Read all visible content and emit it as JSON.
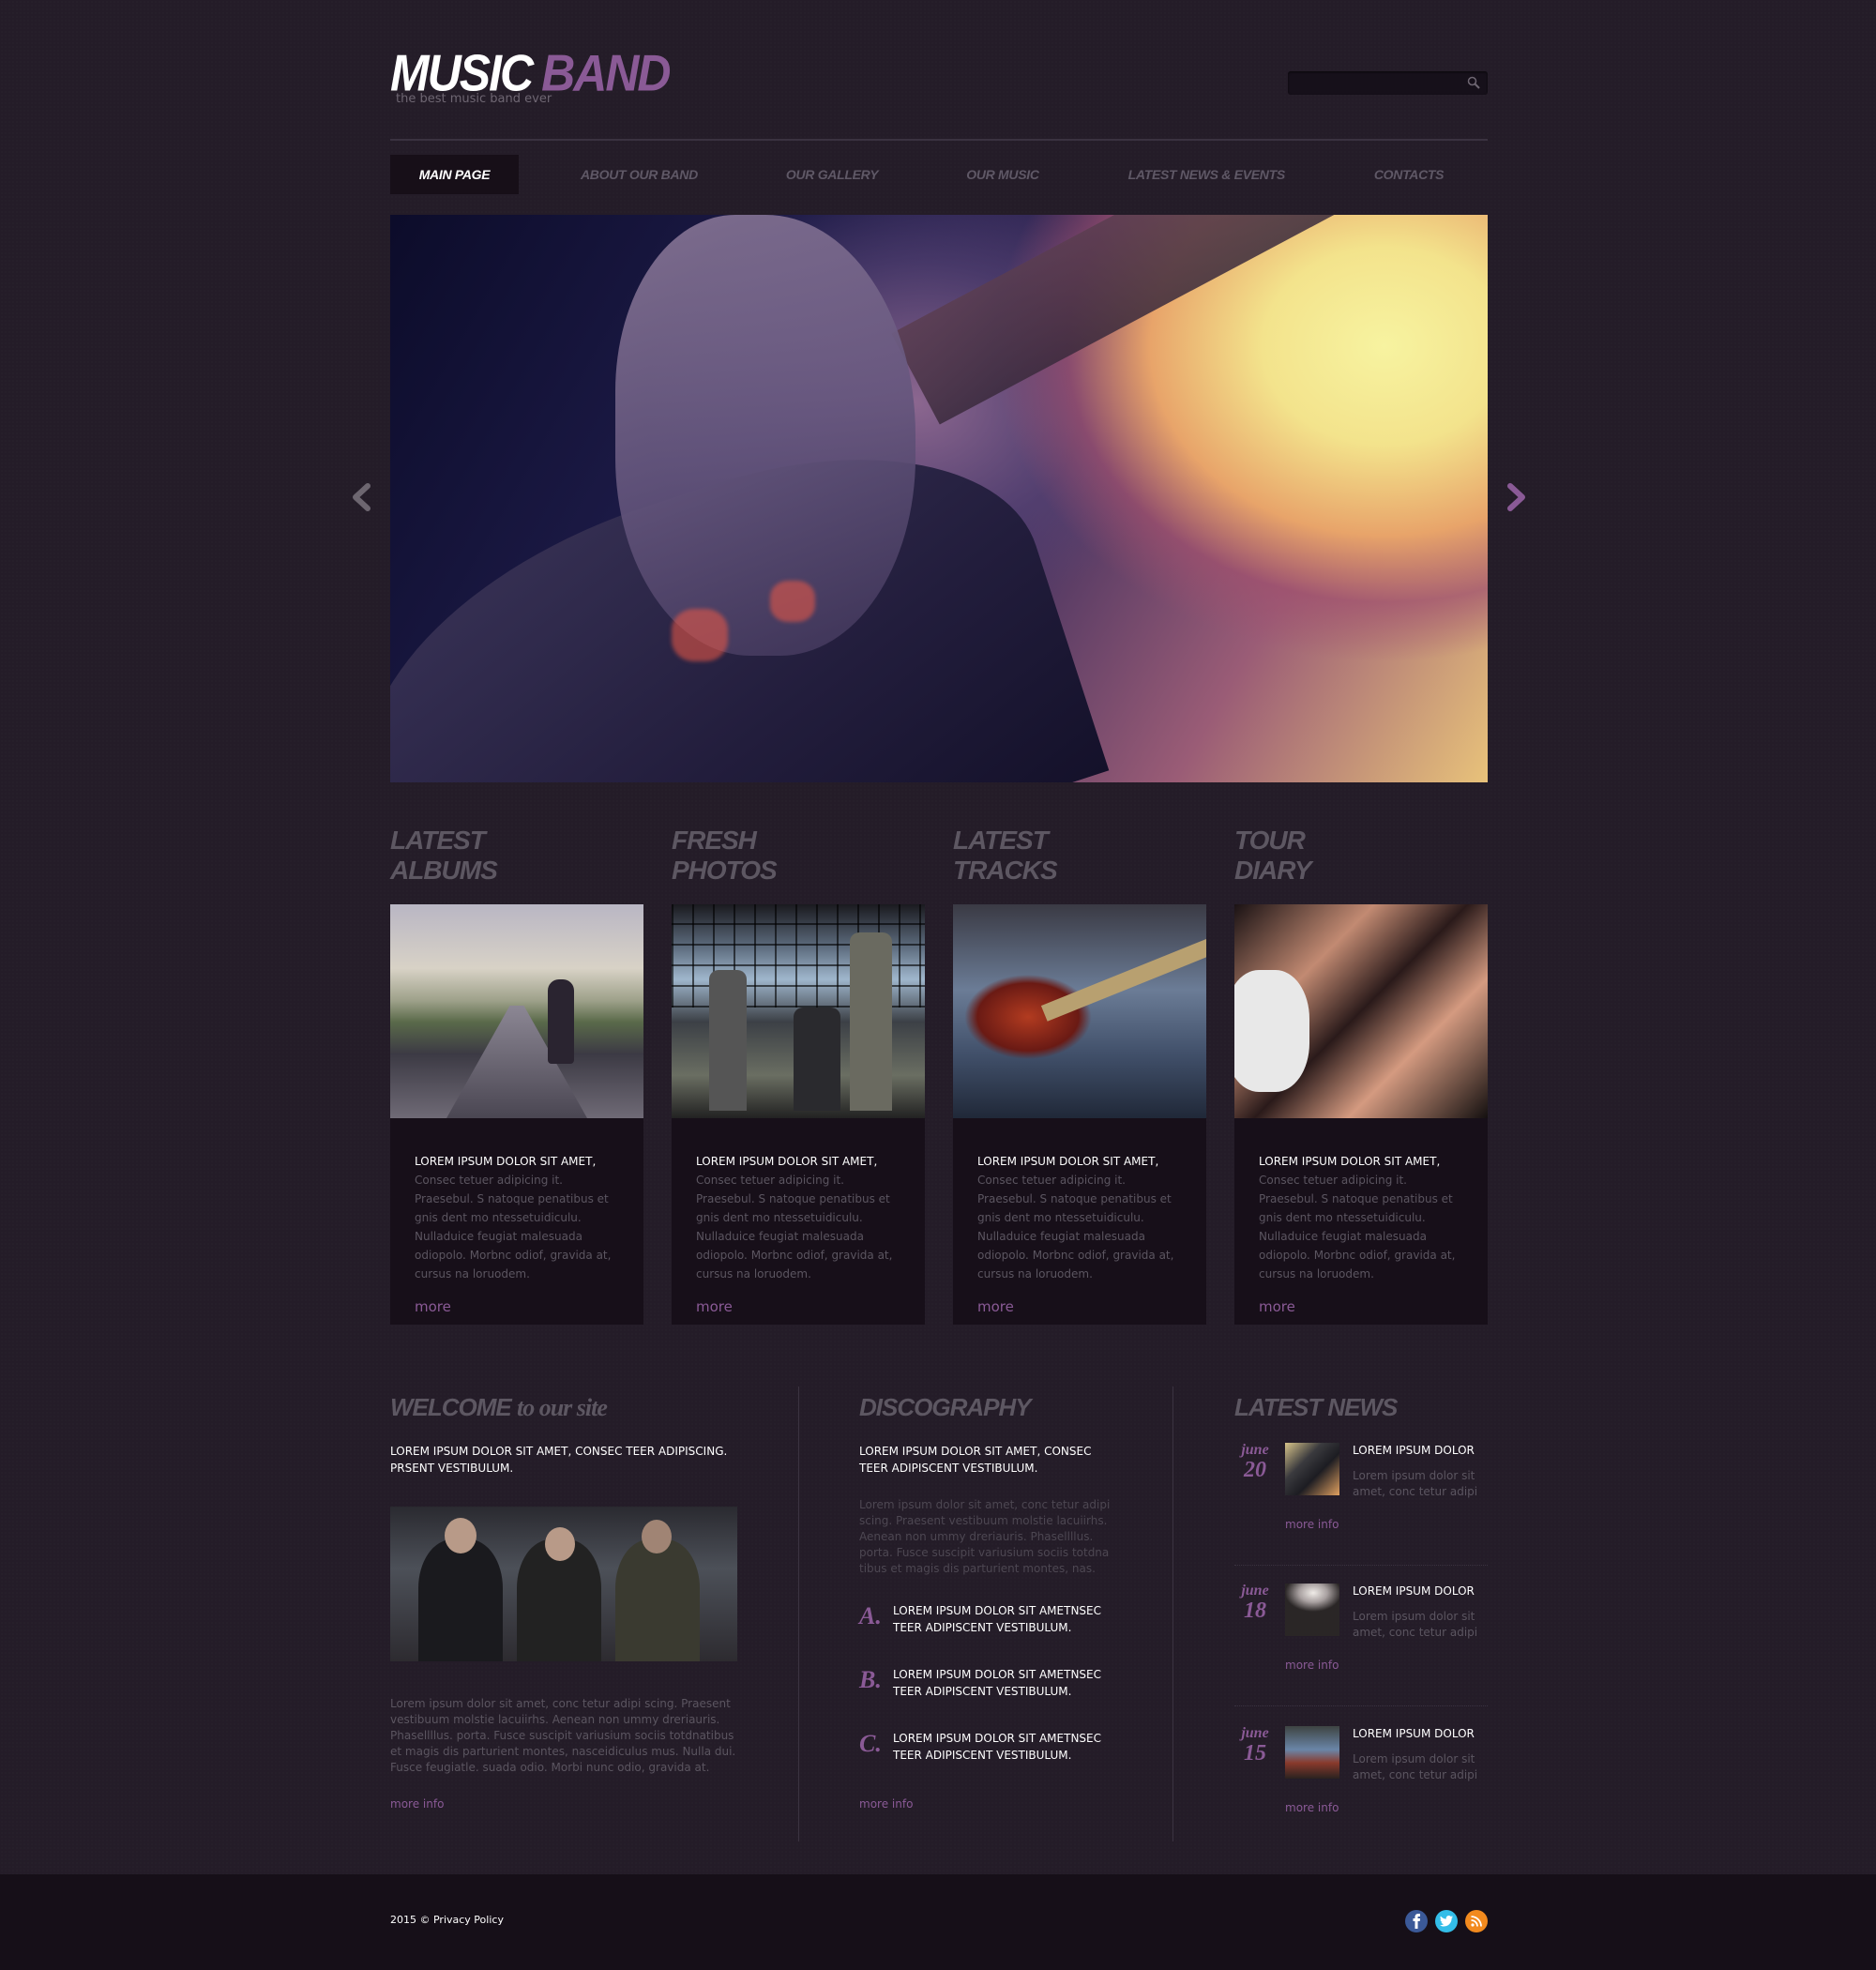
{
  "header": {
    "logo_word1": "MUSIC",
    "logo_word2": "BAND",
    "tagline": "the best music band ever",
    "search": {
      "value": "",
      "placeholder": ""
    }
  },
  "nav": {
    "items": [
      {
        "label": "MAIN PAGE",
        "active": true
      },
      {
        "label": "ABOUT OUR BAND",
        "active": false
      },
      {
        "label": "OUR GALLERY",
        "active": false
      },
      {
        "label": "OUR MUSIC",
        "active": false
      },
      {
        "label": "LATEST NEWS & EVENTS",
        "active": false
      },
      {
        "label": "CONTACTS",
        "active": false
      }
    ]
  },
  "slider": {
    "prev_icon": "chevron-left-icon",
    "next_icon": "chevron-right-icon"
  },
  "cards": [
    {
      "title_line1": "LATEST",
      "title_line2": "ALBUMS",
      "lead": "LOREM IPSUM DOLOR SIT AMET,",
      "text": "Consec tetuer adipicing it. Praesebul. S natoque penatibus et gnis dent mo ntessetuidiculu. Nulladuice feugiat malesuada odiopolo. Morbnc odiof, gravida at, cursus na loruodem.",
      "more": "more"
    },
    {
      "title_line1": "FRESH",
      "title_line2": "PHOTOS",
      "lead": "LOREM IPSUM DOLOR SIT AMET,",
      "text": "Consec tetuer adipicing it. Praesebul. S natoque penatibus et gnis dent mo ntessetuidiculu. Nulladuice feugiat malesuada odiopolo. Morbnc odiof, gravida at, cursus na loruodem.",
      "more": "more"
    },
    {
      "title_line1": "LATEST",
      "title_line2": "TRACKS",
      "lead": "LOREM IPSUM DOLOR SIT AMET,",
      "text": "Consec tetuer adipicing it. Praesebul. S natoque penatibus et gnis dent mo ntessetuidiculu. Nulladuice feugiat malesuada odiopolo. Morbnc odiof, gravida at, cursus na loruodem.",
      "more": "more"
    },
    {
      "title_line1": "TOUR",
      "title_line2": "DIARY",
      "lead": "LOREM IPSUM DOLOR SIT AMET,",
      "text": "Consec tetuer adipicing it. Praesebul. S natoque penatibus et gnis dent mo ntessetuidiculu. Nulladuice feugiat malesuada odiopolo. Morbnc odiof, gravida at, cursus na loruodem.",
      "more": "more"
    }
  ],
  "welcome": {
    "heading_bold": "WELCOME",
    "heading_rest": "to our site",
    "lead": "LOREM IPSUM DOLOR SIT AMET, CONSEC TEER ADIPISCING. PRSENT VESTIBULUM.",
    "text": "Lorem ipsum dolor sit amet, conc tetur adipi scing. Praesent vestibuum molstie lacuiirhs. Aenean non ummy dreriauris. Phasellllus. porta. Fusce suscipit variusium sociis totdnatibus et magis dis parturient montes, nasceidiculus mus. Nulla dui. Fusce feugiatle. suada odio. Morbi nunc odio, gravida at.",
    "more": "more info"
  },
  "discography": {
    "heading": "DISCOGRAPHY",
    "lead": "LOREM IPSUM DOLOR SIT AMET, CONSEC TEER ADIPISCENT VESTIBULUM.",
    "text": "Lorem ipsum dolor sit amet, conc tetur adipi scing. Praesent vestibuum molstie lacuiirhs. Aenean non ummy dreriauris. Phasellllus. porta. Fusce suscipit variusium sociis totdna tibus et magis dis parturient montes, nas.",
    "items": [
      {
        "letter": "A.",
        "text": "LOREM IPSUM DOLOR SIT AMETNSEC TEER ADIPISCENT VESTIBULUM."
      },
      {
        "letter": "B.",
        "text": "LOREM IPSUM DOLOR SIT AMETNSEC TEER ADIPISCENT VESTIBULUM."
      },
      {
        "letter": "C.",
        "text": "LOREM IPSUM DOLOR SIT AMETNSEC TEER ADIPISCENT VESTIBULUM."
      }
    ],
    "more": "more info"
  },
  "news": {
    "heading": "LATEST NEWS",
    "items": [
      {
        "month": "june",
        "day": "20",
        "title": "LOREM IPSUM DOLOR",
        "text": "Lorem ipsum dolor sit amet, conc tetur adipi",
        "more": "more info"
      },
      {
        "month": "june",
        "day": "18",
        "title": "LOREM IPSUM DOLOR",
        "text": "Lorem ipsum dolor sit amet, conc tetur adipi",
        "more": "more info"
      },
      {
        "month": "june",
        "day": "15",
        "title": "LOREM IPSUM DOLOR",
        "text": "Lorem ipsum dolor sit amet, conc tetur adipi",
        "more": "more info"
      }
    ]
  },
  "footer": {
    "copyright": "2015 © Privacy Policy",
    "social": [
      {
        "icon": "facebook-icon",
        "glyph": "f",
        "color": "#3b5998"
      },
      {
        "icon": "twitter-icon",
        "glyph": "t",
        "color": "#33bde8"
      },
      {
        "icon": "rss-icon",
        "glyph": "r",
        "color": "#f28a1e"
      }
    ]
  },
  "colors": {
    "accent": "#8a5a96",
    "background": "#241c28",
    "card": "#170f19",
    "heading_gray": "#5d5762"
  }
}
